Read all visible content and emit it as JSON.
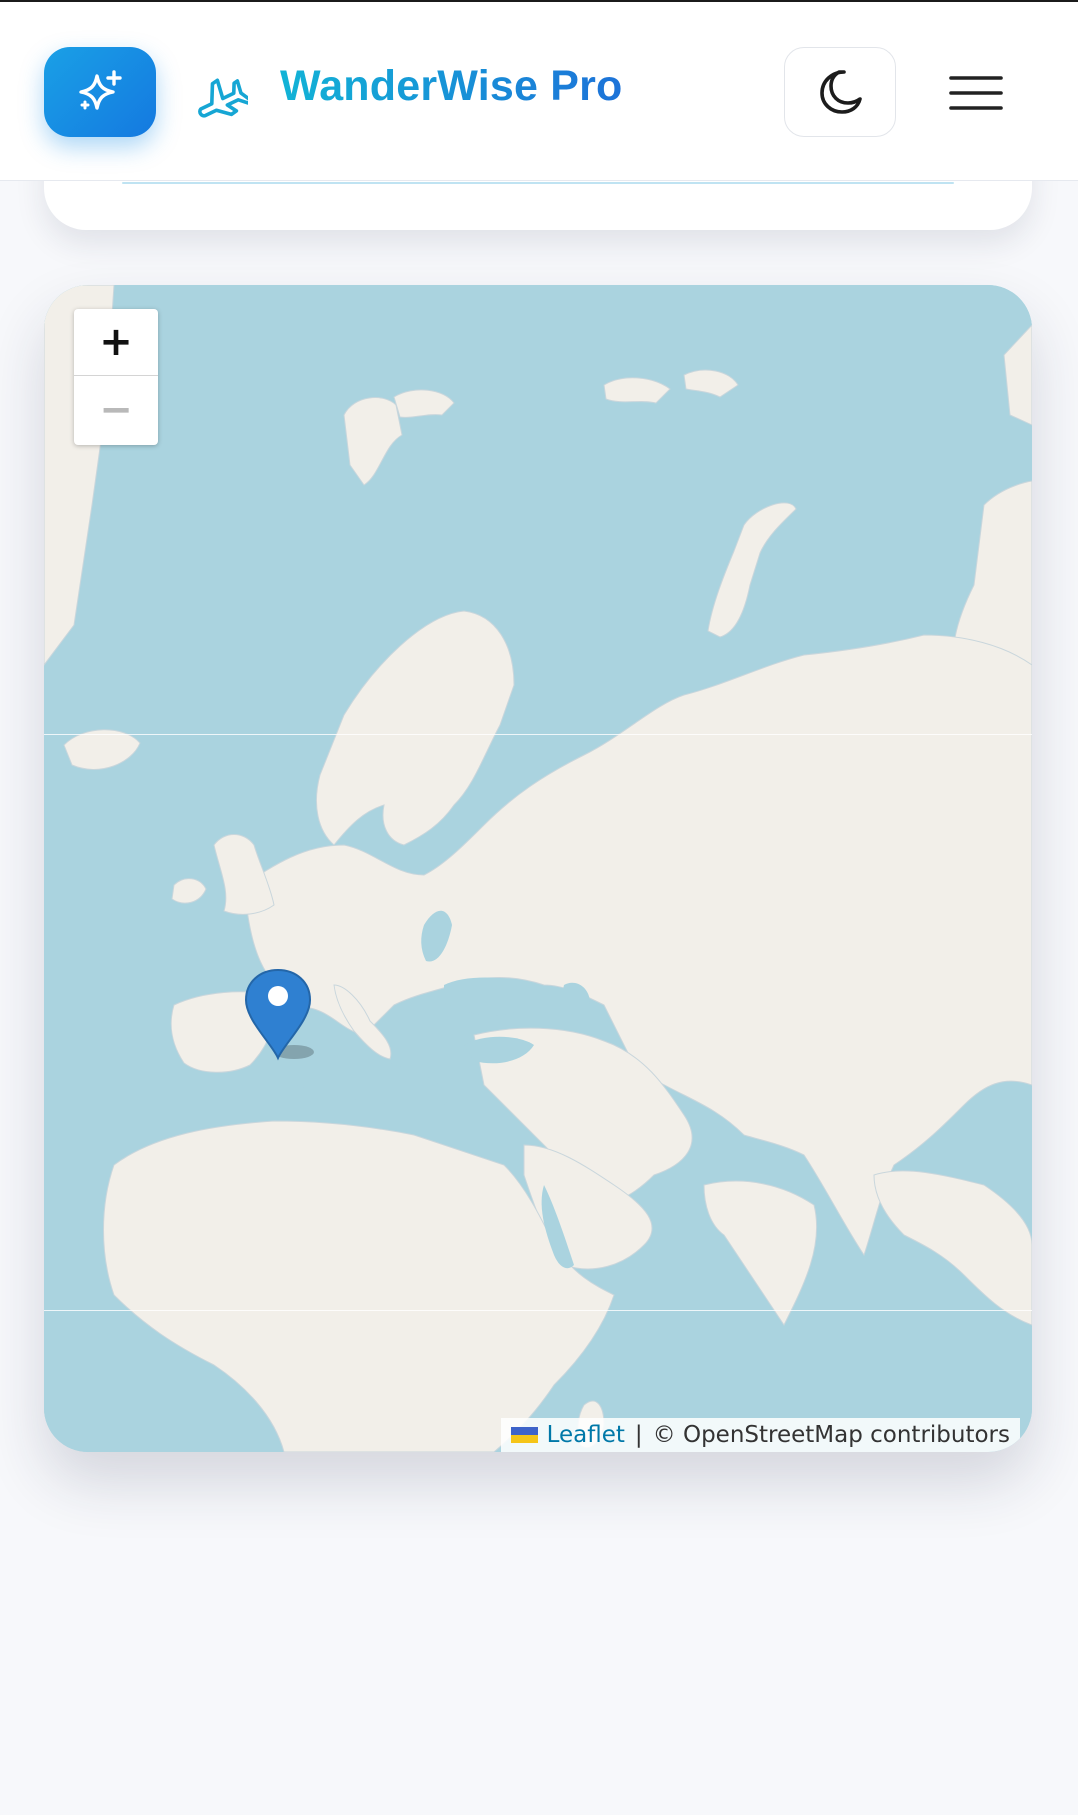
{
  "header": {
    "brand": "WanderWise Pro",
    "icons": {
      "sparkle": "sparkle-icon",
      "plane": "plane-icon",
      "theme": "moon-icon",
      "menu": "hamburger-menu-icon"
    },
    "colors": {
      "brand_start": "#12b3d6",
      "brand_end": "#1d72d8",
      "sparkle_button": "#1479e0"
    }
  },
  "map": {
    "zoom_in_label": "+",
    "zoom_out_label": "−",
    "marker_icon": "map-pin-icon",
    "marker_color": "#2f80d1",
    "water_color": "#aad3df",
    "land_color": "#f2efe9",
    "attribution": {
      "leaflet": "Leaflet",
      "separator": "|",
      "osm": "© OpenStreetMap contributors"
    }
  }
}
